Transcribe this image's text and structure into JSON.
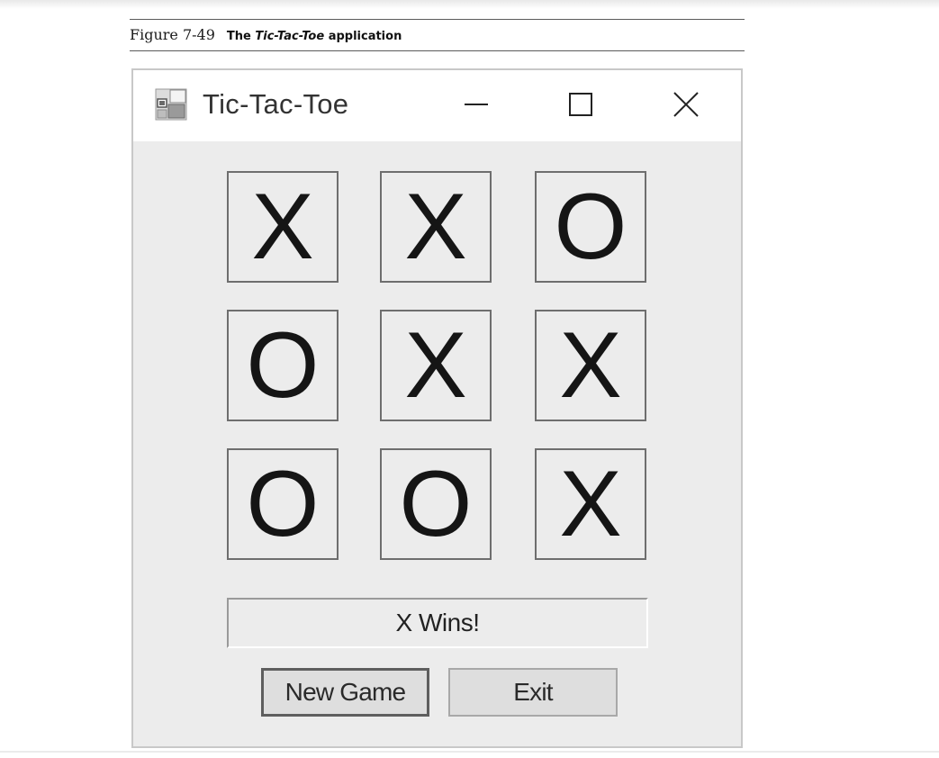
{
  "caption": {
    "figure_number": "Figure 7-49",
    "title_prefix": "The",
    "title_app": "Tic-Tac-Toe",
    "title_suffix": "application"
  },
  "window": {
    "title": "Tic-Tac-Toe",
    "controls": [
      "minimize-icon",
      "maximize-icon",
      "close-icon"
    ]
  },
  "board": {
    "cells": [
      "X",
      "X",
      "O",
      "O",
      "X",
      "X",
      "O",
      "O",
      "X"
    ]
  },
  "status": "X Wins!",
  "buttons": {
    "new_game": "New Game",
    "exit": "Exit"
  }
}
